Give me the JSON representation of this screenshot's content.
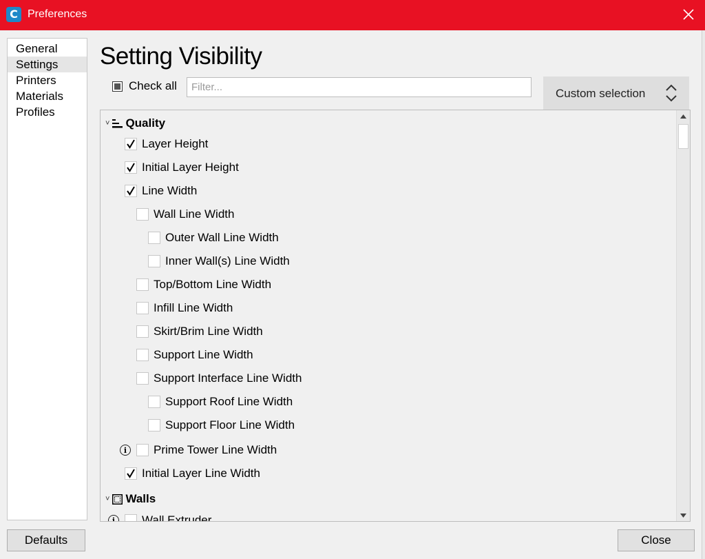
{
  "window": {
    "title": "Preferences",
    "icon_letter": "C",
    "icon_color": "#1e88c8",
    "titlebar_color": "#e81123"
  },
  "sidebar": {
    "items": [
      {
        "label": "General",
        "active": false
      },
      {
        "label": "Settings",
        "active": true
      },
      {
        "label": "Printers",
        "active": false
      },
      {
        "label": "Materials",
        "active": false
      },
      {
        "label": "Profiles",
        "active": false
      }
    ]
  },
  "main": {
    "heading": "Setting Visibility",
    "check_all_label": "Check all",
    "check_all_state": "partial",
    "filter_placeholder": "Filter...",
    "filter_value": "",
    "preset_select": "Custom selection"
  },
  "settings": {
    "quality": {
      "label": "Quality",
      "icon": "quality-bars-icon",
      "items": [
        {
          "label": "Layer Height",
          "checked": true
        },
        {
          "label": "Initial Layer Height",
          "checked": true
        },
        {
          "label": "Line Width",
          "checked": true
        },
        {
          "label": "Wall Line Width",
          "checked": false
        },
        {
          "label": "Outer Wall Line Width",
          "checked": false
        },
        {
          "label": "Inner Wall(s) Line Width",
          "checked": false
        },
        {
          "label": "Top/Bottom Line Width",
          "checked": false
        },
        {
          "label": "Infill Line Width",
          "checked": false
        },
        {
          "label": "Skirt/Brim Line Width",
          "checked": false
        },
        {
          "label": "Support Line Width",
          "checked": false
        },
        {
          "label": "Support Interface Line Width",
          "checked": false
        },
        {
          "label": "Support Roof Line Width",
          "checked": false
        },
        {
          "label": "Support Floor Line Width",
          "checked": false
        },
        {
          "label": "Prime Tower Line Width",
          "checked": false,
          "info": true
        },
        {
          "label": "Initial Layer Line Width",
          "checked": true
        }
      ]
    },
    "walls": {
      "label": "Walls",
      "icon": "walls-grid-icon",
      "items": [
        {
          "label": "Wall Extruder",
          "checked": false,
          "info": true
        }
      ]
    }
  },
  "buttons": {
    "defaults": "Defaults",
    "close": "Close"
  }
}
